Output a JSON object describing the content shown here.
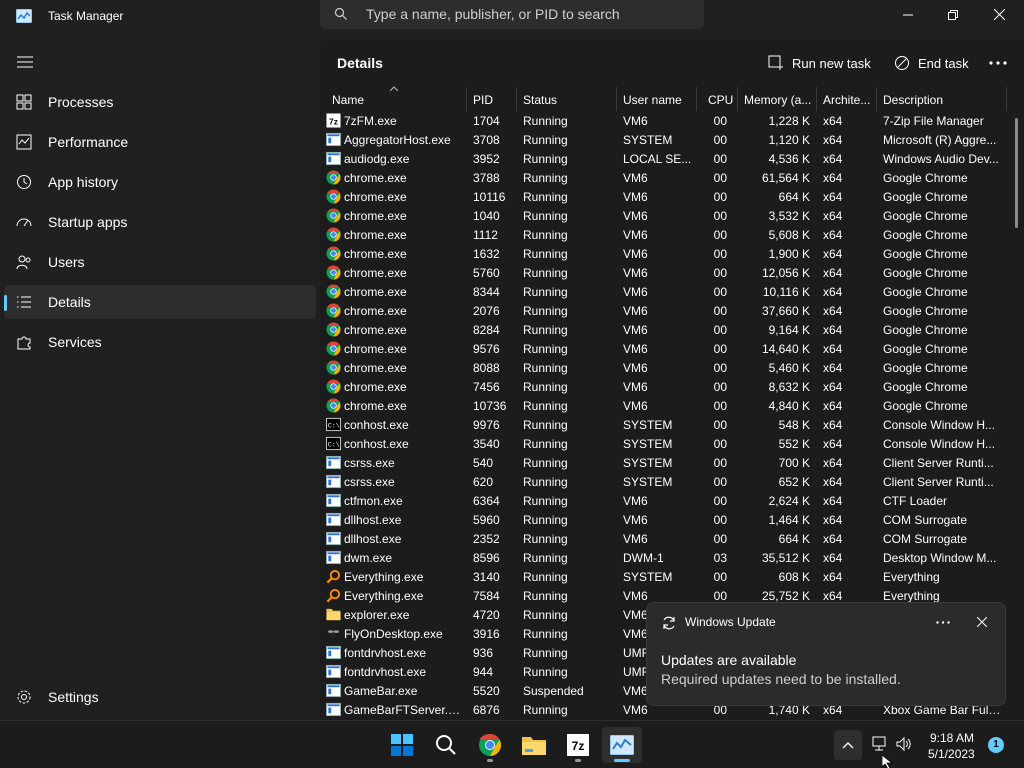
{
  "app": {
    "title": "Task Manager",
    "search_placeholder": "Type a name, publisher, or PID to search"
  },
  "sidebar": {
    "items": [
      {
        "label": "Processes",
        "icon": "processes-grid-icon"
      },
      {
        "label": "Performance",
        "icon": "performance-graph-icon"
      },
      {
        "label": "App history",
        "icon": "history-clock-icon"
      },
      {
        "label": "Startup apps",
        "icon": "startup-gauge-icon"
      },
      {
        "label": "Users",
        "icon": "users-icon"
      },
      {
        "label": "Details",
        "icon": "details-list-icon",
        "active": true
      },
      {
        "label": "Services",
        "icon": "services-puzzle-icon"
      }
    ],
    "settings_label": "Settings"
  },
  "main": {
    "title": "Details",
    "run_new_task_label": "Run new task",
    "end_task_label": "End task"
  },
  "table": {
    "columns": [
      "Name",
      "PID",
      "Status",
      "User name",
      "CPU",
      "Memory (a...",
      "Archite...",
      "Description"
    ],
    "rows": [
      {
        "icon": "7zip",
        "name": "7zFM.exe",
        "pid": "1704",
        "status": "Running",
        "user": "VM6",
        "cpu": "00",
        "mem": "1,228 K",
        "arch": "x64",
        "desc": "7-Zip File Manager"
      },
      {
        "icon": "app",
        "name": "AggregatorHost.exe",
        "pid": "3708",
        "status": "Running",
        "user": "SYSTEM",
        "cpu": "00",
        "mem": "1,120 K",
        "arch": "x64",
        "desc": "Microsoft (R) Aggre..."
      },
      {
        "icon": "app",
        "name": "audiodg.exe",
        "pid": "3952",
        "status": "Running",
        "user": "LOCAL SE...",
        "cpu": "00",
        "mem": "4,536 K",
        "arch": "x64",
        "desc": "Windows Audio Dev..."
      },
      {
        "icon": "chrome",
        "name": "chrome.exe",
        "pid": "3788",
        "status": "Running",
        "user": "VM6",
        "cpu": "00",
        "mem": "61,564 K",
        "arch": "x64",
        "desc": "Google Chrome"
      },
      {
        "icon": "chrome",
        "name": "chrome.exe",
        "pid": "10116",
        "status": "Running",
        "user": "VM6",
        "cpu": "00",
        "mem": "664 K",
        "arch": "x64",
        "desc": "Google Chrome"
      },
      {
        "icon": "chrome",
        "name": "chrome.exe",
        "pid": "1040",
        "status": "Running",
        "user": "VM6",
        "cpu": "00",
        "mem": "3,532 K",
        "arch": "x64",
        "desc": "Google Chrome"
      },
      {
        "icon": "chrome",
        "name": "chrome.exe",
        "pid": "1112",
        "status": "Running",
        "user": "VM6",
        "cpu": "00",
        "mem": "5,608 K",
        "arch": "x64",
        "desc": "Google Chrome"
      },
      {
        "icon": "chrome",
        "name": "chrome.exe",
        "pid": "1632",
        "status": "Running",
        "user": "VM6",
        "cpu": "00",
        "mem": "1,900 K",
        "arch": "x64",
        "desc": "Google Chrome"
      },
      {
        "icon": "chrome",
        "name": "chrome.exe",
        "pid": "5760",
        "status": "Running",
        "user": "VM6",
        "cpu": "00",
        "mem": "12,056 K",
        "arch": "x64",
        "desc": "Google Chrome"
      },
      {
        "icon": "chrome",
        "name": "chrome.exe",
        "pid": "8344",
        "status": "Running",
        "user": "VM6",
        "cpu": "00",
        "mem": "10,116 K",
        "arch": "x64",
        "desc": "Google Chrome"
      },
      {
        "icon": "chrome",
        "name": "chrome.exe",
        "pid": "2076",
        "status": "Running",
        "user": "VM6",
        "cpu": "00",
        "mem": "37,660 K",
        "arch": "x64",
        "desc": "Google Chrome"
      },
      {
        "icon": "chrome",
        "name": "chrome.exe",
        "pid": "8284",
        "status": "Running",
        "user": "VM6",
        "cpu": "00",
        "mem": "9,164 K",
        "arch": "x64",
        "desc": "Google Chrome"
      },
      {
        "icon": "chrome",
        "name": "chrome.exe",
        "pid": "9576",
        "status": "Running",
        "user": "VM6",
        "cpu": "00",
        "mem": "14,640 K",
        "arch": "x64",
        "desc": "Google Chrome"
      },
      {
        "icon": "chrome",
        "name": "chrome.exe",
        "pid": "8088",
        "status": "Running",
        "user": "VM6",
        "cpu": "00",
        "mem": "5,460 K",
        "arch": "x64",
        "desc": "Google Chrome"
      },
      {
        "icon": "chrome",
        "name": "chrome.exe",
        "pid": "7456",
        "status": "Running",
        "user": "VM6",
        "cpu": "00",
        "mem": "8,632 K",
        "arch": "x64",
        "desc": "Google Chrome"
      },
      {
        "icon": "chrome",
        "name": "chrome.exe",
        "pid": "10736",
        "status": "Running",
        "user": "VM6",
        "cpu": "00",
        "mem": "4,840 K",
        "arch": "x64",
        "desc": "Google Chrome"
      },
      {
        "icon": "console",
        "name": "conhost.exe",
        "pid": "9976",
        "status": "Running",
        "user": "SYSTEM",
        "cpu": "00",
        "mem": "548 K",
        "arch": "x64",
        "desc": "Console Window H..."
      },
      {
        "icon": "console",
        "name": "conhost.exe",
        "pid": "3540",
        "status": "Running",
        "user": "SYSTEM",
        "cpu": "00",
        "mem": "552 K",
        "arch": "x64",
        "desc": "Console Window H..."
      },
      {
        "icon": "app",
        "name": "csrss.exe",
        "pid": "540",
        "status": "Running",
        "user": "SYSTEM",
        "cpu": "00",
        "mem": "700 K",
        "arch": "x64",
        "desc": "Client Server Runti..."
      },
      {
        "icon": "app",
        "name": "csrss.exe",
        "pid": "620",
        "status": "Running",
        "user": "SYSTEM",
        "cpu": "00",
        "mem": "652 K",
        "arch": "x64",
        "desc": "Client Server Runti..."
      },
      {
        "icon": "app",
        "name": "ctfmon.exe",
        "pid": "6364",
        "status": "Running",
        "user": "VM6",
        "cpu": "00",
        "mem": "2,624 K",
        "arch": "x64",
        "desc": "CTF Loader"
      },
      {
        "icon": "app",
        "name": "dllhost.exe",
        "pid": "5960",
        "status": "Running",
        "user": "VM6",
        "cpu": "00",
        "mem": "1,464 K",
        "arch": "x64",
        "desc": "COM Surrogate"
      },
      {
        "icon": "app",
        "name": "dllhost.exe",
        "pid": "2352",
        "status": "Running",
        "user": "VM6",
        "cpu": "00",
        "mem": "664 K",
        "arch": "x64",
        "desc": "COM Surrogate"
      },
      {
        "icon": "app",
        "name": "dwm.exe",
        "pid": "8596",
        "status": "Running",
        "user": "DWM-1",
        "cpu": "03",
        "mem": "35,512 K",
        "arch": "x64",
        "desc": "Desktop Window M..."
      },
      {
        "icon": "search",
        "name": "Everything.exe",
        "pid": "3140",
        "status": "Running",
        "user": "SYSTEM",
        "cpu": "00",
        "mem": "608 K",
        "arch": "x64",
        "desc": "Everything"
      },
      {
        "icon": "search",
        "name": "Everything.exe",
        "pid": "7584",
        "status": "Running",
        "user": "VM6",
        "cpu": "00",
        "mem": "25,752 K",
        "arch": "x64",
        "desc": "Everything"
      },
      {
        "icon": "folder",
        "name": "explorer.exe",
        "pid": "4720",
        "status": "Running",
        "user": "VM6",
        "cpu": "",
        "mem": "",
        "arch": "",
        "desc": ""
      },
      {
        "icon": "fly",
        "name": "FlyOnDesktop.exe",
        "pid": "3916",
        "status": "Running",
        "user": "VM6",
        "cpu": "",
        "mem": "",
        "arch": "",
        "desc": ""
      },
      {
        "icon": "app",
        "name": "fontdrvhost.exe",
        "pid": "936",
        "status": "Running",
        "user": "UMF",
        "cpu": "",
        "mem": "",
        "arch": "",
        "desc": ""
      },
      {
        "icon": "app",
        "name": "fontdrvhost.exe",
        "pid": "944",
        "status": "Running",
        "user": "UMF",
        "cpu": "",
        "mem": "",
        "arch": "",
        "desc": ""
      },
      {
        "icon": "app",
        "name": "GameBar.exe",
        "pid": "5520",
        "status": "Suspended",
        "user": "VM6",
        "cpu": "",
        "mem": "",
        "arch": "",
        "desc": ""
      },
      {
        "icon": "app",
        "name": "GameBarFTServer.exe",
        "pid": "6876",
        "status": "Running",
        "user": "VM6",
        "cpu": "00",
        "mem": "1,740 K",
        "arch": "x64",
        "desc": "Xbox Game Bar Full ..."
      }
    ]
  },
  "toast": {
    "app_name": "Windows Update",
    "title": "Updates are available",
    "body": "Required updates need to be installed."
  },
  "taskbar": {
    "time": "9:18 AM",
    "date": "5/1/2023",
    "notification_count": "1"
  },
  "colors": {
    "accent": "#60cdff",
    "background": "#1c1c1c",
    "chrome_red": "#db4437",
    "chrome_green": "#0f9d58",
    "chrome_yellow": "#f4b400"
  }
}
